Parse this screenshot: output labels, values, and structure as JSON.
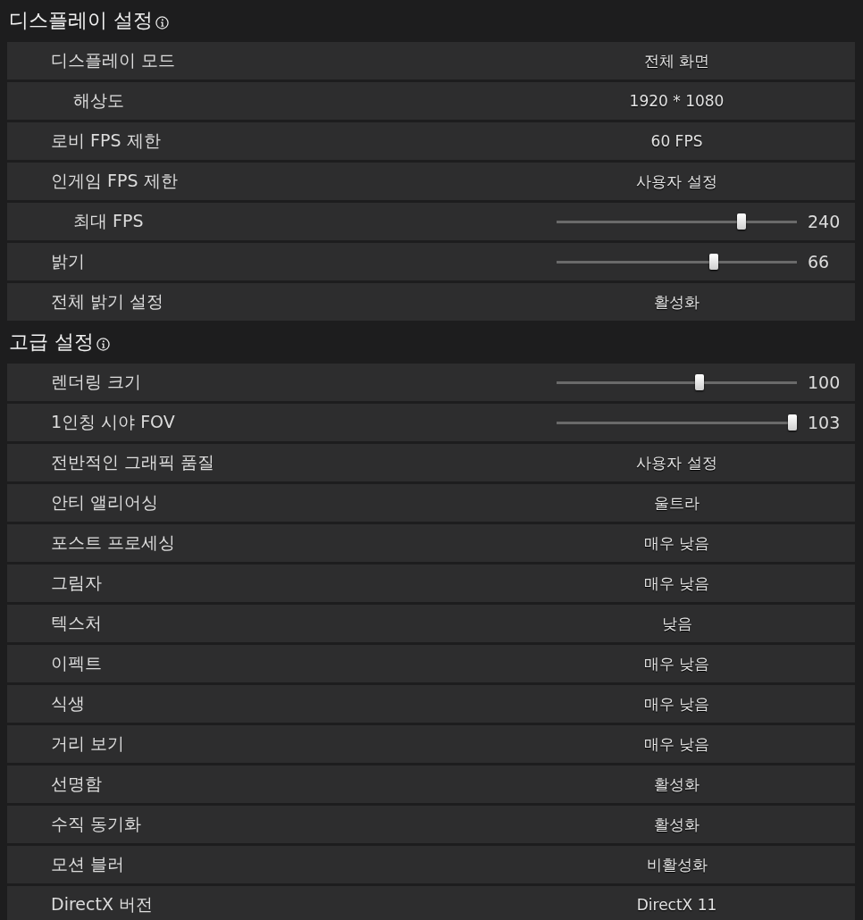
{
  "sections": [
    {
      "title": "디스플레이 설정",
      "settings": [
        {
          "label": "디스플레이 모드",
          "kind": "choice",
          "value": "전체 화면",
          "children": [
            {
              "label": "해상도",
              "kind": "choice",
              "value": "1920 * 1080"
            }
          ]
        },
        {
          "label": "로비 FPS 제한",
          "kind": "choice",
          "value": "60 FPS"
        },
        {
          "label": "인게임 FPS 제한",
          "kind": "choice",
          "value": "사용자 설정",
          "children": [
            {
              "label": "최대 FPS",
              "kind": "slider",
              "level": 0.78,
              "reading": "240"
            }
          ]
        },
        {
          "label": "밝기",
          "kind": "slider",
          "level": 0.66,
          "reading": "66"
        },
        {
          "label": "전체 밝기 설정",
          "kind": "choice",
          "value": "활성화"
        }
      ]
    },
    {
      "title": "고급 설정",
      "settings": [
        {
          "label": "렌더링 크기",
          "kind": "slider",
          "level": 0.6,
          "reading": "100"
        },
        {
          "label": "1인칭 시야 FOV",
          "kind": "slider",
          "level": 1.0,
          "reading": "103"
        },
        {
          "label": "전반적인 그래픽 품질",
          "kind": "choice",
          "value": "사용자 설정"
        },
        {
          "label": "안티 앨리어싱",
          "kind": "choice",
          "value": "울트라"
        },
        {
          "label": "포스트 프로세싱",
          "kind": "choice",
          "value": "매우 낮음"
        },
        {
          "label": "그림자",
          "kind": "choice",
          "value": "매우 낮음"
        },
        {
          "label": "텍스처",
          "kind": "choice",
          "value": "낮음"
        },
        {
          "label": "이펙트",
          "kind": "choice",
          "value": "매우 낮음"
        },
        {
          "label": "식생",
          "kind": "choice",
          "value": "매우 낮음"
        },
        {
          "label": "거리 보기",
          "kind": "choice",
          "value": "매우 낮음"
        },
        {
          "label": "선명함",
          "kind": "choice",
          "value": "활성화"
        },
        {
          "label": "수직 동기화",
          "kind": "choice",
          "value": "활성화"
        },
        {
          "label": "모션 블러",
          "kind": "choice",
          "value": "비활성화"
        },
        {
          "label": "DirectX 버전",
          "kind": "choice",
          "value": "DirectX 11"
        }
      ]
    }
  ]
}
